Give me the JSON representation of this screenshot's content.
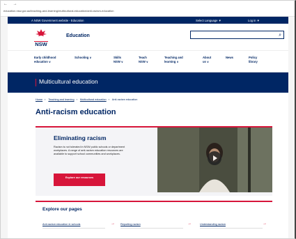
{
  "browser": {
    "nav": "← →",
    "url": "education.nsw.gov.au/teaching-and-learning/multicultural-education/anti-racism-education"
  },
  "masthead": {
    "gov_text": "A NSW Government website - Education",
    "language": "Select Language ▼",
    "login": "Log in"
  },
  "header": {
    "logo_text": "NSW",
    "brand": "Education",
    "search_placeholder": ""
  },
  "nav": [
    {
      "line1": "Early childhood",
      "line2": "education ∨"
    },
    {
      "line1": "Schooling ∨",
      "line2": ""
    },
    {
      "line1": "Skills",
      "line2": "NSW ∨"
    },
    {
      "line1": "Teach",
      "line2": "NSW ∨"
    },
    {
      "line1": "Teaching and",
      "line2": "learning ∨"
    },
    {
      "line1": "About",
      "line2": "us ∨"
    },
    {
      "line1": "News",
      "line2": ""
    },
    {
      "line1": "Policy",
      "line2": "library"
    }
  ],
  "hero": {
    "title": "Multicultural education"
  },
  "breadcrumbs": [
    "Home",
    "Teaching and learning",
    "Multicultural education",
    "Anti-racism education"
  ],
  "page_title": "Anti-racism education",
  "feature": {
    "title": "Eliminating racism",
    "description": "Racism is not tolerated in NSW public schools or department workplaces. A range of anti-racism education resources are available to support school communities and workplaces.",
    "cta": "Explore our resources"
  },
  "explore": {
    "title": "Explore our pages",
    "links": [
      "Anti-racism education in schools",
      "Reporting racism",
      "Understanding racism"
    ]
  },
  "colors": {
    "navy": "#002664",
    "red": "#d7153a"
  }
}
